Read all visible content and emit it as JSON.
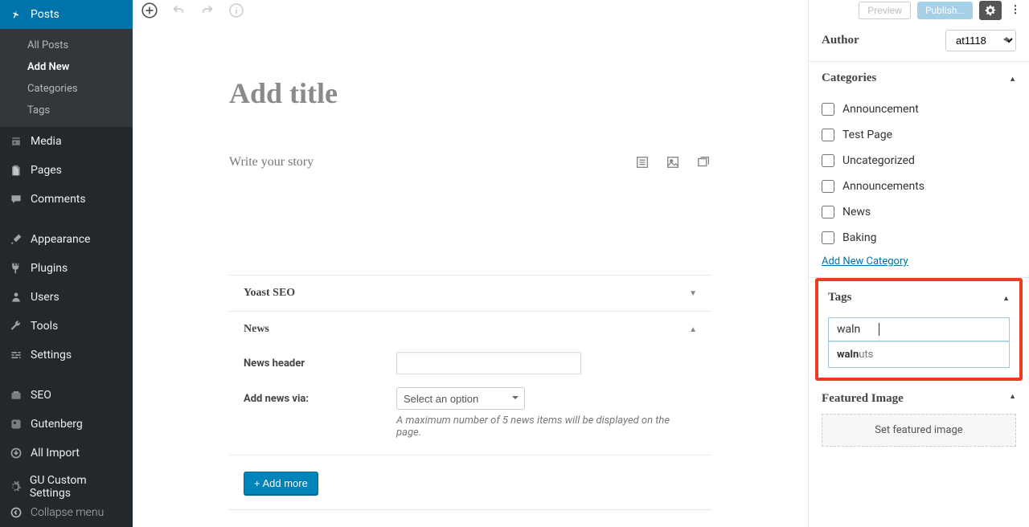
{
  "sidebar": {
    "items": [
      {
        "label": "Posts",
        "icon": "pin"
      },
      {
        "label": "Media",
        "icon": "media"
      },
      {
        "label": "Pages",
        "icon": "pages"
      },
      {
        "label": "Comments",
        "icon": "comment"
      },
      {
        "label": "Appearance",
        "icon": "brush"
      },
      {
        "label": "Plugins",
        "icon": "plug"
      },
      {
        "label": "Users",
        "icon": "user"
      },
      {
        "label": "Tools",
        "icon": "wrench"
      },
      {
        "label": "Settings",
        "icon": "sliders"
      },
      {
        "label": "SEO",
        "icon": "seo"
      },
      {
        "label": "Gutenberg",
        "icon": "gutenberg"
      },
      {
        "label": "All Import",
        "icon": "import"
      },
      {
        "label": "GU Custom Settings",
        "icon": "gear"
      }
    ],
    "posts_submenu": [
      "All Posts",
      "Add New",
      "Categories",
      "Tags"
    ],
    "collapse": "Collapse menu"
  },
  "editor": {
    "title_placeholder": "Add title",
    "story_placeholder": "Write your story"
  },
  "panels": {
    "yoast": "Yoast SEO",
    "news": {
      "title": "News",
      "header_label": "News header",
      "add_via_label": "Add news via:",
      "select_placeholder": "Select an option",
      "hint": "A maximum number of 5 news items will be displayed on the page.",
      "add_more": "+ Add more"
    }
  },
  "topbar": {
    "preview": "Preview",
    "publish": "Publish..."
  },
  "right": {
    "author_label": "Author",
    "author_value": "at1118",
    "categories_title": "Categories",
    "categories": [
      "Announcement",
      "Test Page",
      "Uncategorized",
      "Announcements",
      "News",
      "Baking"
    ],
    "add_category": "Add New Category",
    "tags_title": "Tags",
    "tags_input": "waln",
    "tags_suggest_bold": "waln",
    "tags_suggest_rest": "uts",
    "featured_title": "Featured Image",
    "featured_button": "Set featured image"
  }
}
